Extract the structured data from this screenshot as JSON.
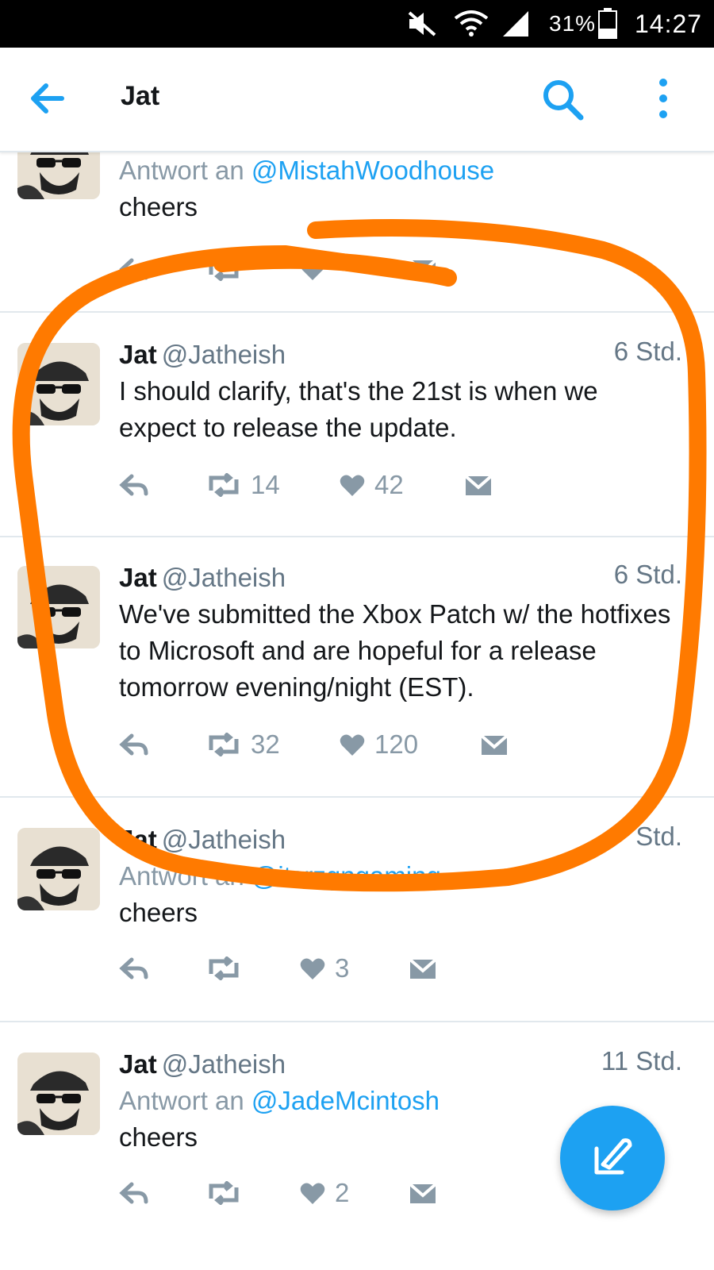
{
  "status_bar": {
    "battery": "31%",
    "time": "14:27",
    "icons": [
      "mute-icon",
      "wifi-icon",
      "signal-icon",
      "battery-icon"
    ]
  },
  "header": {
    "title": "Jat",
    "icons": [
      "back-arrow-icon",
      "search-icon",
      "more-vertical-icon"
    ]
  },
  "tweets": [
    {
      "reply_prefix": "Antwort an",
      "reply_to": "@MistahWoodhouse",
      "body": "cheers"
    },
    {
      "name": "Jat",
      "handle": "@Jatheish",
      "time": "6 Std.",
      "body": "I should clarify, that's the 21st is when we expect to release the update.",
      "retweets": "14",
      "likes": "42"
    },
    {
      "name": "Jat",
      "handle": "@Jatheish",
      "time": "6 Std.",
      "body": "We've submitted the Xbox Patch w/ the hotfixes to Microsoft and are hopeful for a release tomorrow evening/night (EST).",
      "retweets": "32",
      "likes": "120"
    },
    {
      "name": "Jat",
      "handle": "@Jatheish",
      "time": "Std.",
      "reply_prefix": "Antwort an",
      "reply_to": "@itsrzgngaming",
      "body": "cheers",
      "likes": "3"
    },
    {
      "name": "Jat",
      "handle": "@Jatheish",
      "time": "11 Std.",
      "reply_prefix": "Antwort an",
      "reply_to": "@JadeMcintosh",
      "body": "cheers",
      "likes": "2"
    }
  ],
  "colors": {
    "accent": "#1da1f2",
    "annotation": "#ff7a00",
    "muted": "#8899a6"
  }
}
